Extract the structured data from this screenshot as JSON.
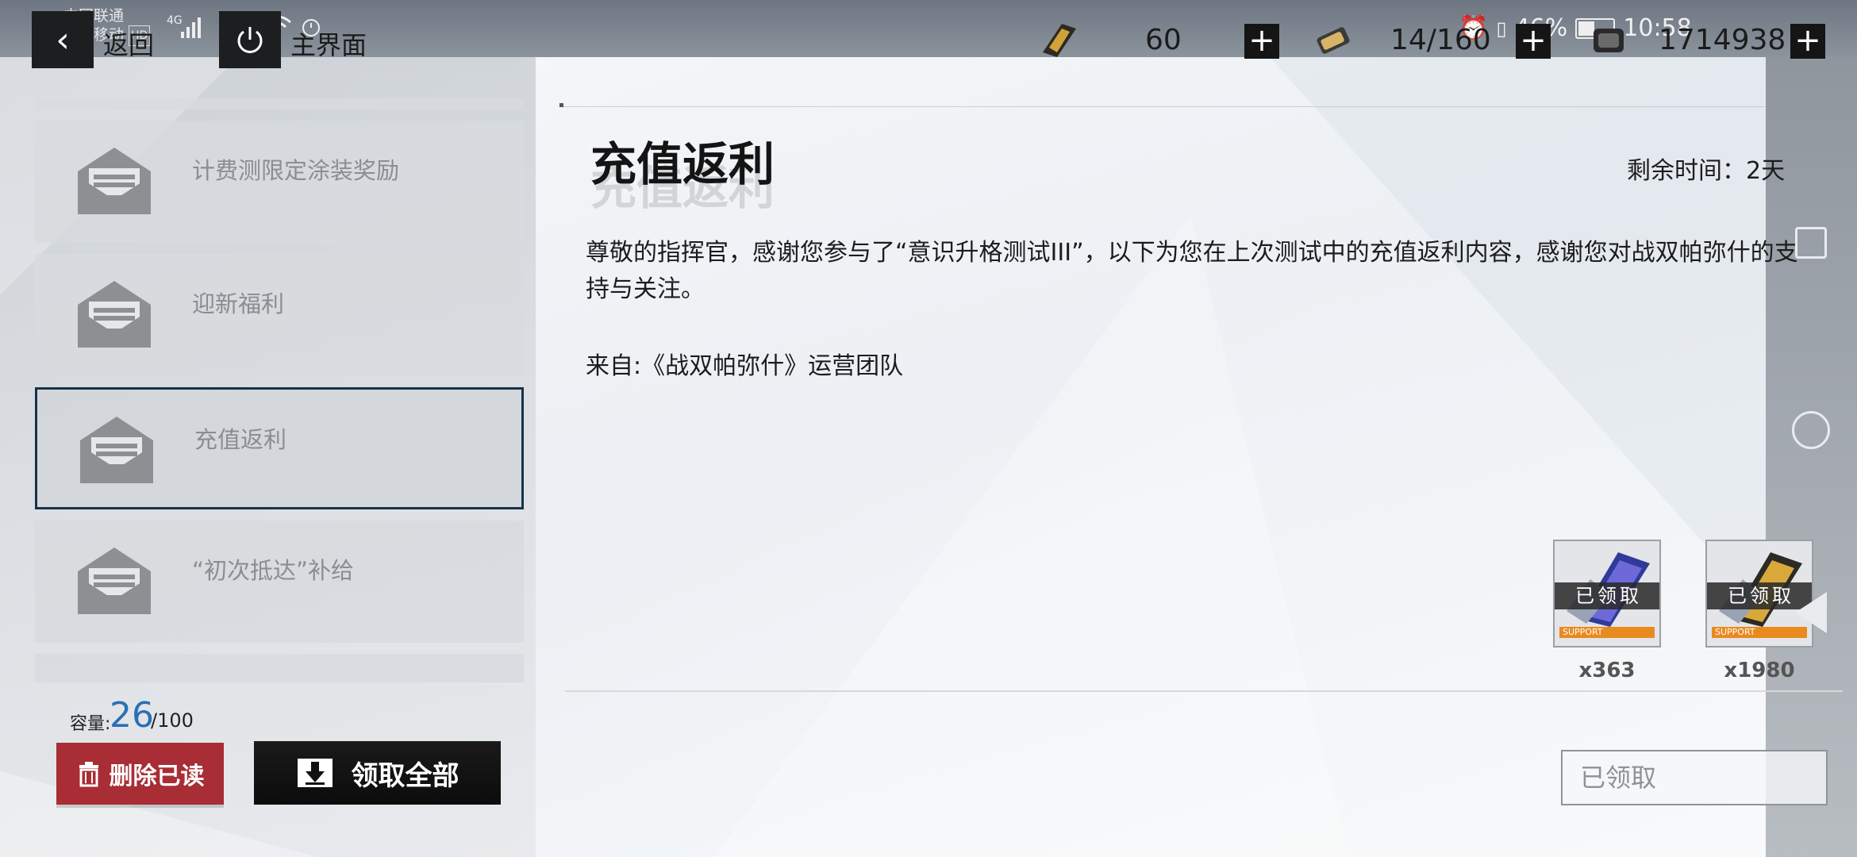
{
  "status_bar": {
    "carrier1": "中国联通",
    "carrier2": "中国移动",
    "hd": "HD",
    "net1": "4G",
    "net2": "4G",
    "battery": "46%",
    "time": "10:58"
  },
  "nav": {
    "back_label": "返回",
    "home_label": "主界面"
  },
  "resources": [
    {
      "icon": "ticket-icon",
      "value": "60"
    },
    {
      "icon": "battery-stamina-icon",
      "value": "14/160"
    },
    {
      "icon": "coin-icon",
      "value": "1714938"
    }
  ],
  "mail_list": [
    {
      "title": "计费测限定涂装奖励",
      "selected": false
    },
    {
      "title": "迎新福利",
      "selected": false
    },
    {
      "title": "充值返利",
      "selected": true
    },
    {
      "title": "“初次抵达”补给",
      "selected": false
    }
  ],
  "capacity": {
    "label": "容量:",
    "count": "26",
    "max": "/100"
  },
  "actions": {
    "delete_read": "删除已读",
    "claim_all": "领取全部"
  },
  "mail": {
    "title": "充值返利",
    "remaining": "剩余时间：2天",
    "body": "尊敬的指挥官，感谢您参与了“意识升格测试III”，以下为您在上次测试中的充值返利内容，感谢您对战双帕弥什的支持与关注。",
    "from": "来自:《战双帕弥什》运营团队",
    "rewards": [
      {
        "badge": "已领取",
        "tag": "SUPPORT",
        "qty": "x363",
        "color": "#3a3f8c"
      },
      {
        "badge": "已领取",
        "tag": "SUPPORT",
        "qty": "x1980",
        "color": "#c79a2a"
      }
    ],
    "claimed_button": "已领取"
  }
}
